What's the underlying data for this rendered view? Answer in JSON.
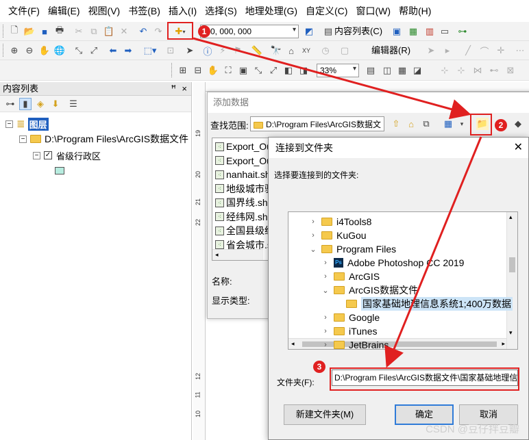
{
  "menu": [
    "文件(F)",
    "编辑(E)",
    "视图(V)",
    "书签(B)",
    "插入(I)",
    "选择(S)",
    "地理处理(G)",
    "自定义(C)",
    "窗口(W)",
    "帮助(H)"
  ],
  "toolbar": {
    "scale_value": "1:0, 000, 000",
    "toc_button": "内容列表(C)",
    "editor_label": "编辑器(R)",
    "zoom_value": "33%"
  },
  "toc": {
    "title": "内容列表",
    "pin": "ᵖ",
    "close": "×",
    "layers_label": "图层",
    "path": "D:\\Program Files\\ArcGIS数据文件",
    "layer_name": "省级行政区"
  },
  "add_data": {
    "title": "添加数据",
    "lookin_label": "查找范围:",
    "lookin_value": "D:\\Program Files\\ArcGIS数据文",
    "files": [
      "Export_Ou",
      "Export_Ou",
      "nanhait.sh",
      "地级城市驻",
      "国界线.shp",
      "经纬网.shp",
      "全国县级统",
      "省会城市.s"
    ],
    "name_label": "名称:",
    "type_label": "显示类型:"
  },
  "connect": {
    "title": "连接到文件夹",
    "close": "✕",
    "prompt": "选择要连接到的文件夹:",
    "tree": [
      {
        "label": "i4Tools8",
        "chev": ">",
        "indent": 0,
        "kind": "folder"
      },
      {
        "label": "KuGou",
        "chev": ">",
        "indent": 0,
        "kind": "folder"
      },
      {
        "label": "Program Files",
        "chev": "v",
        "indent": 0,
        "kind": "folder"
      },
      {
        "label": "Adobe Photoshop CC 2019",
        "chev": ">",
        "indent": 1,
        "kind": "ps"
      },
      {
        "label": "ArcGIS",
        "chev": ">",
        "indent": 1,
        "kind": "folder"
      },
      {
        "label": "ArcGIS数据文件",
        "chev": "v",
        "indent": 1,
        "kind": "folder"
      },
      {
        "label": "国家基础地理信息系统1;400万数据",
        "chev": "",
        "indent": 2,
        "kind": "folder",
        "selected": true
      },
      {
        "label": "Google",
        "chev": ">",
        "indent": 1,
        "kind": "folder"
      },
      {
        "label": "iTunes",
        "chev": ">",
        "indent": 1,
        "kind": "folder"
      },
      {
        "label": "JetBrains",
        "chev": ">",
        "indent": 1,
        "kind": "folder"
      }
    ],
    "folder_label": "文件夹(F):",
    "folder_value": "D:\\Program Files\\ArcGIS数据文件\\国家基础地理信",
    "new_folder": "新建文件夹(M)",
    "ok": "确定",
    "cancel": "取消"
  },
  "annotations": {
    "step1": "1",
    "step2": "2",
    "step3": "3",
    "color": "#e02020"
  },
  "watermark": "CSDN @豆仔拌豆瓣",
  "ruler_numbers": [
    "19",
    "20",
    "21",
    "22",
    "12",
    "11",
    "10"
  ]
}
